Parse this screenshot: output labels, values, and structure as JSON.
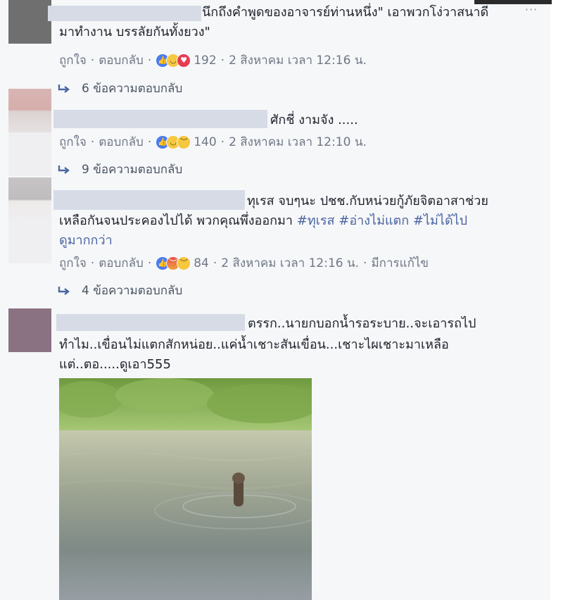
{
  "comments": [
    {
      "text_lines": [
        "นึกถึงคำพูดของอาจารย์ท่านหนึ่ง\" เอาพวกโง่วาสนาดี",
        "มาทำงาน บรรลัยกันทั้งยวง\""
      ],
      "actions": {
        "like": "ถูกใจ",
        "reply": "ตอบกลับ"
      },
      "reaction_count": "192",
      "timestamp": "2 สิงหาคม เวลา 12:16 น.",
      "replies_label": "6 ข้อความตอบกลับ"
    },
    {
      "text_lines": [
        "ศักชี่ งามจัง ....."
      ],
      "actions": {
        "like": "ถูกใจ",
        "reply": "ตอบกลับ"
      },
      "reaction_count": "140",
      "timestamp": "2 สิงหาคม เวลา 12:10 น.",
      "replies_label": "9 ข้อความตอบกลับ"
    },
    {
      "text_line1": "ทุเรส จบๆนะ ปชช.กับหน่วยกู้ภัยจิตอาสาช่วย",
      "text_line2_plain": "เหลือกันจนประคองไปได้ พวกคุณพึ่งออกมา ",
      "hashtags": [
        "#ทุเรส",
        "#อ่างไม่แตก",
        "#ไม่ได้ไป"
      ],
      "text_line3": "ดูมากกว่า",
      "actions": {
        "like": "ถูกใจ",
        "reply": "ตอบกลับ"
      },
      "reaction_count": "84",
      "timestamp": "2 สิงหาคม เวลา 12:16 น.",
      "edited": "มีการแก้ไข",
      "replies_label": "4 ข้อความตอบกลับ"
    },
    {
      "text_lines": [
        "ตรรก..นายกบอกน้ำรอระบาย..จะเอารถไป",
        "ทำไม..เขื่อนไม่แตกสักหน่อย..แค่น้ำเชาะสันเขื่อน...เชาะไผเชาะมาเหลือ",
        "แต่..ตอ.....ดูเอา555"
      ]
    }
  ],
  "icons": [
    "more-options-icon",
    "reply-arrow-icon",
    "like-reaction-icon",
    "haha-reaction-icon",
    "angry-reaction-icon",
    "sad-reaction-icon",
    "love-reaction-icon"
  ],
  "colors": {
    "background": "#f6f7f9",
    "text": "#1d2129",
    "meta": "#6f7785",
    "hashtag": "#4a64a0",
    "like_blue": "#4a7bf0"
  }
}
